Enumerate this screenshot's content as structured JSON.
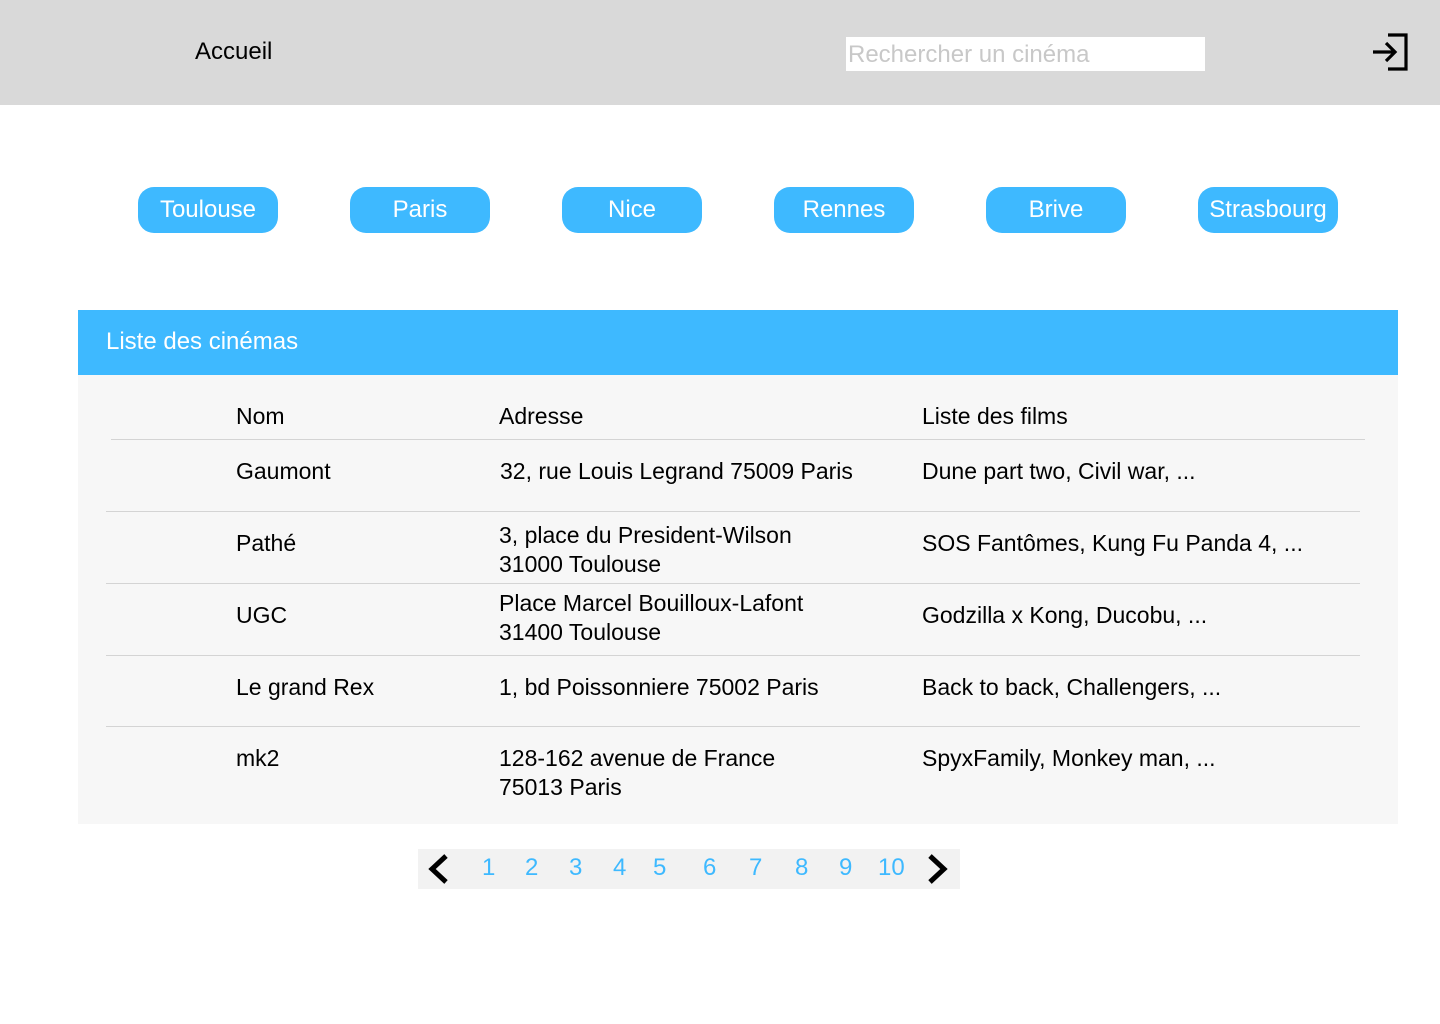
{
  "nav": {
    "home_label": "Accueil",
    "search_placeholder": "Rechercher un cinéma",
    "logout_icon": "logout-icon"
  },
  "cities": [
    "Toulouse",
    "Paris",
    "Nice",
    "Rennes",
    "Brive",
    "Strasbourg"
  ],
  "panel": {
    "title": "Liste des cinémas",
    "columns": [
      "Nom",
      "Adresse",
      "Liste des films"
    ],
    "rows": [
      {
        "name": "Gaumont",
        "address": [
          "32, rue Louis Legrand 75009 Paris"
        ],
        "films": "Dune part two, Civil war, ..."
      },
      {
        "name": "Pathé",
        "address": [
          "3, place du President-Wilson",
          "31000 Toulouse"
        ],
        "films": "SOS Fantômes, Kung Fu Panda 4, ..."
      },
      {
        "name": "UGC",
        "address": [
          "Place Marcel Bouilloux-Lafont",
          "31400 Toulouse"
        ],
        "films": "Godzilla x Kong, Ducobu, ..."
      },
      {
        "name": "Le grand Rex",
        "address": [
          "1, bd Poissonniere 75002 Paris"
        ],
        "films": "Back to back, Challengers, ..."
      },
      {
        "name": "mk2",
        "address": [
          "128-162 avenue de France",
          "75013 Paris"
        ],
        "films": "SpyxFamily, Monkey man, ..."
      }
    ]
  },
  "pagination": {
    "pages": [
      "1",
      "2",
      "3",
      "4",
      "5",
      "6",
      "7",
      "8",
      "9",
      "10"
    ],
    "prev_icon": "chevron-left-icon",
    "next_icon": "chevron-right-icon"
  },
  "colors": {
    "accent": "#3eb9ff",
    "topbar": "#d9d9d9",
    "panel_body": "#f7f7f7"
  }
}
